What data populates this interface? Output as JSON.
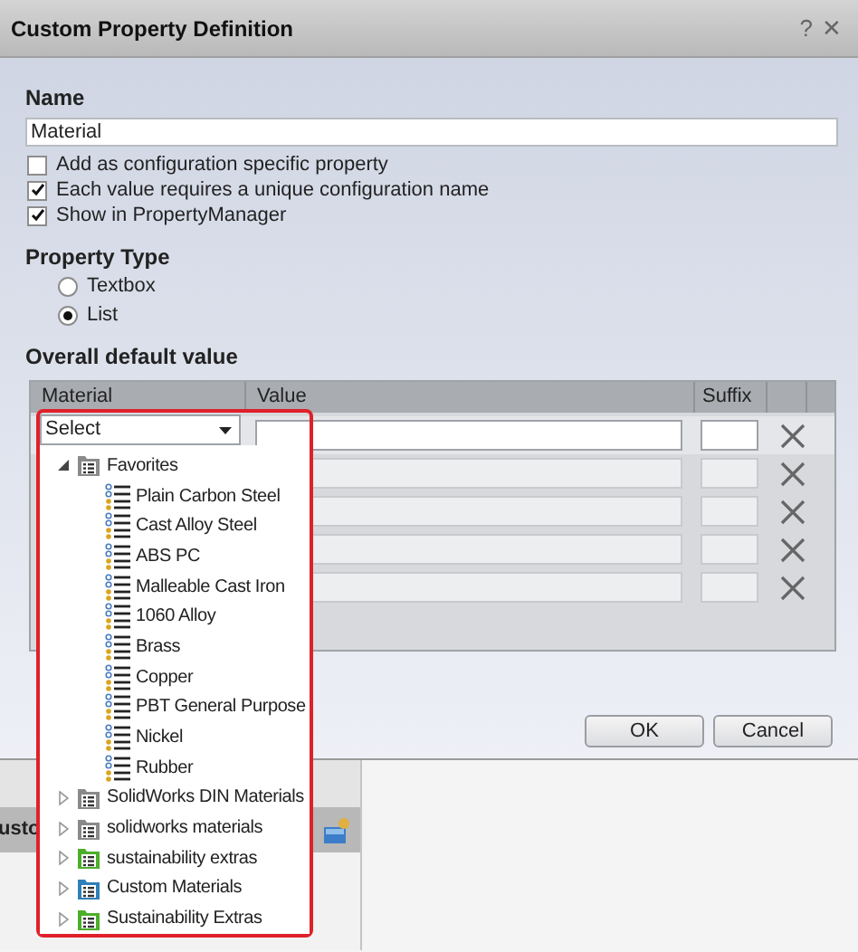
{
  "dialog": {
    "title": "Custom Property Definition",
    "help": "?",
    "close": "✕",
    "name_label": "Name",
    "name_value": "Material",
    "options": [
      {
        "label": "Add as configuration specific property",
        "checked": false
      },
      {
        "label": "Each value requires a unique configuration name",
        "checked": true
      },
      {
        "label": "Show in PropertyManager",
        "checked": true
      }
    ],
    "property_type_label": "Property Type",
    "property_types": [
      {
        "label": "Textbox",
        "selected": false
      },
      {
        "label": "List",
        "selected": true
      }
    ],
    "default_value_label": "Overall default value",
    "grid": {
      "columns": [
        "Material",
        "Value",
        "Suffix"
      ],
      "rows": [
        {
          "disabled": false
        },
        {
          "disabled": true
        },
        {
          "disabled": true
        },
        {
          "disabled": true
        },
        {
          "disabled": true
        }
      ]
    },
    "buttons": [
      "OK",
      "Cancel"
    ]
  },
  "material_dropdown": {
    "value": "Select",
    "tree": [
      {
        "label": "Favorites",
        "color": "#8a8a8a",
        "expanded": true,
        "children": [
          {
            "label": "Plain Carbon Steel"
          },
          {
            "label": "Cast Alloy Steel"
          },
          {
            "label": "ABS PC"
          },
          {
            "label": "Malleable Cast Iron"
          },
          {
            "label": "1060 Alloy"
          },
          {
            "label": "Brass"
          },
          {
            "label": "Copper"
          },
          {
            "label": "PBT General Purpose"
          },
          {
            "label": "Nickel"
          },
          {
            "label": "Rubber"
          }
        ]
      },
      {
        "label": "SolidWorks DIN Materials",
        "color": "#8a8a8a",
        "expanded": false
      },
      {
        "label": "solidworks materials",
        "color": "#8a8a8a",
        "expanded": false
      },
      {
        "label": "sustainability extras",
        "color": "#4caf2a",
        "expanded": false
      },
      {
        "label": "Custom Materials",
        "color": "#2f7fb8",
        "expanded": false
      },
      {
        "label": "Sustainability Extras",
        "color": "#4caf2a",
        "expanded": false
      }
    ]
  },
  "background_panel": {
    "title": "usto"
  }
}
